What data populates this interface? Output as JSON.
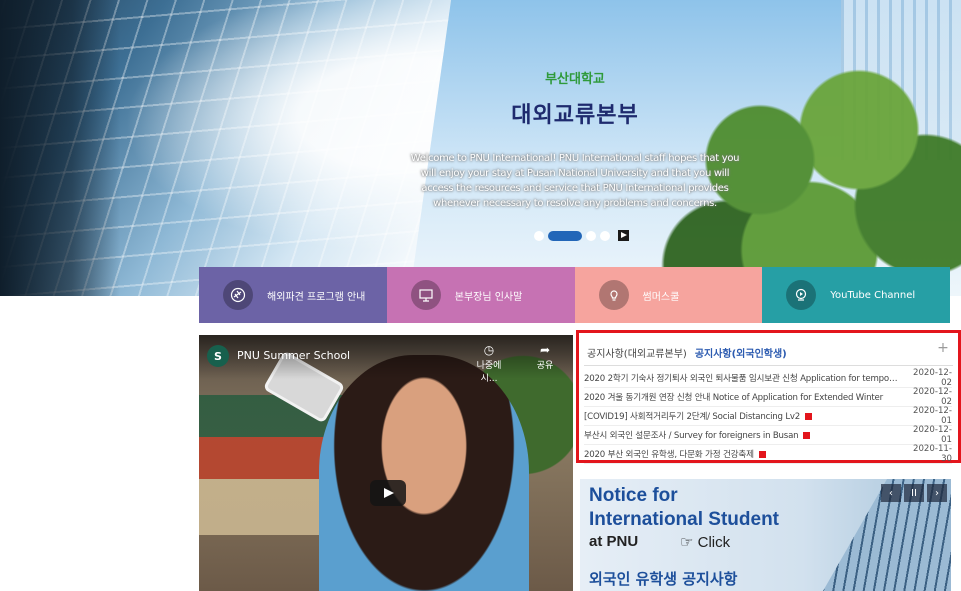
{
  "hero": {
    "subtitle": "부산대학교",
    "title": "대외교류본부",
    "description": "Welcome to PNU International! PNU International staff hopes that you will enjoy your stay at Pusan National University and that you will access the resources and service that PNU International provides whenever necessary to resolve any problems and concerns.",
    "active_slide": 2
  },
  "quick_menu": [
    {
      "label": "해외파견 프로그램 안내",
      "icon": "airplane-icon"
    },
    {
      "label": "본부장님 인사말",
      "icon": "monitor-icon"
    },
    {
      "label": "썸머스쿨",
      "icon": "lightbulb-icon"
    },
    {
      "label": "YouTube Channel",
      "icon": "youtube-icon"
    }
  ],
  "video": {
    "channel_initial": "S",
    "title": "PNU Summer School",
    "watch_later_label": "나중에 시...",
    "share_label": "공유"
  },
  "notice": {
    "tab_main": "공지사항(대외교류본부)",
    "tab_intl": "공지사항(외국인학생)",
    "more": "+",
    "items": [
      {
        "title": "2020 2학기 기숙사 정기퇴사 외국인 퇴사물품 임시보관 신청 Application for temporary storage",
        "date": "2020-12-02",
        "new": false
      },
      {
        "title": "2020 겨울 동기개원 연장 신청 안내 Notice of Application for Extended Winter",
        "date": "2020-12-02",
        "new": false
      },
      {
        "title": "[COVID19] 사회적거리두기 2단계/ Social Distancing Lv2",
        "date": "2020-12-01",
        "new": true
      },
      {
        "title": "부산시 외국인 설문조사 / Survey for foreigners in Busan",
        "date": "2020-12-01",
        "new": true
      },
      {
        "title": "2020 부산 외국인 유학생, 다문화 가정 건강축제",
        "date": "2020-11-30",
        "new": true
      }
    ]
  },
  "banner": {
    "line1": "Notice for",
    "line2": "International Student",
    "line3": "at PNU",
    "click": "☞ Click",
    "line4": "외국인 유학생 공지사항",
    "prev": "‹",
    "pause": "II",
    "next": "›"
  }
}
